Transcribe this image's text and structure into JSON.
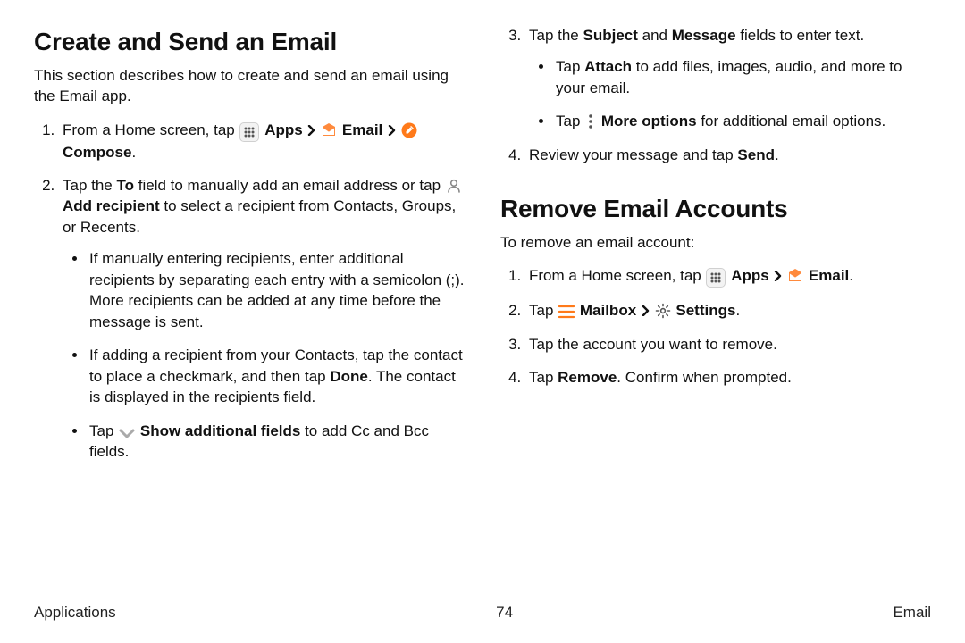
{
  "left": {
    "heading": "Create and Send an Email",
    "intro": "This section describes how to create and send an email using the Email app.",
    "step1_pre": "From a Home screen, tap ",
    "step1_apps": "Apps",
    "step1_email": "Email",
    "step1_compose": "Compose",
    "step2_a": "Tap the ",
    "step2_to": "To",
    "step2_b": " field to manually add an email address or tap ",
    "step2_add_recipient": "Add recipient",
    "step2_c": " to select a recipient from Contacts, Groups, or Recents.",
    "step2_bullet1": "If manually entering recipients, enter additional recipients by separating each entry with a semicolon (;). More recipients can be added at any time before the message is sent.",
    "step2_bullet2_a": "If adding a recipient from your Contacts, tap the contact to place a checkmark, and then tap ",
    "step2_bullet2_done": "Done",
    "step2_bullet2_b": ". The contact is displayed in the recipients field.",
    "step2_bullet3_a": "Tap ",
    "step2_bullet3_show": "Show additional fields",
    "step2_bullet3_b": " to add Cc and Bcc fields."
  },
  "right": {
    "step3_a": "Tap the ",
    "step3_subject": "Subject",
    "step3_and": " and ",
    "step3_message": "Message",
    "step3_b": " fields to enter text.",
    "step3_bullet1_a": "Tap ",
    "step3_bullet1_attach": "Attach",
    "step3_bullet1_b": " to add files, images, audio, and more to your email.",
    "step3_bullet2_a": "Tap ",
    "step3_bullet2_more": "More options",
    "step3_bullet2_b": " for additional email options.",
    "step4_a": "Review your message and tap ",
    "step4_send": "Send",
    "step4_b": ".",
    "heading2": "Remove Email Accounts",
    "intro2": "To remove an email account:",
    "r1_pre": "From a Home screen, tap ",
    "r1_apps": "Apps",
    "r1_email": "Email",
    "r2_a": "Tap ",
    "r2_mailbox": "Mailbox",
    "r2_settings": "Settings",
    "r3": "Tap the account you want to remove.",
    "r4_a": "Tap ",
    "r4_remove": "Remove",
    "r4_b": ". Confirm when prompted."
  },
  "footer": {
    "left": "Applications",
    "center": "74",
    "right": "Email"
  }
}
